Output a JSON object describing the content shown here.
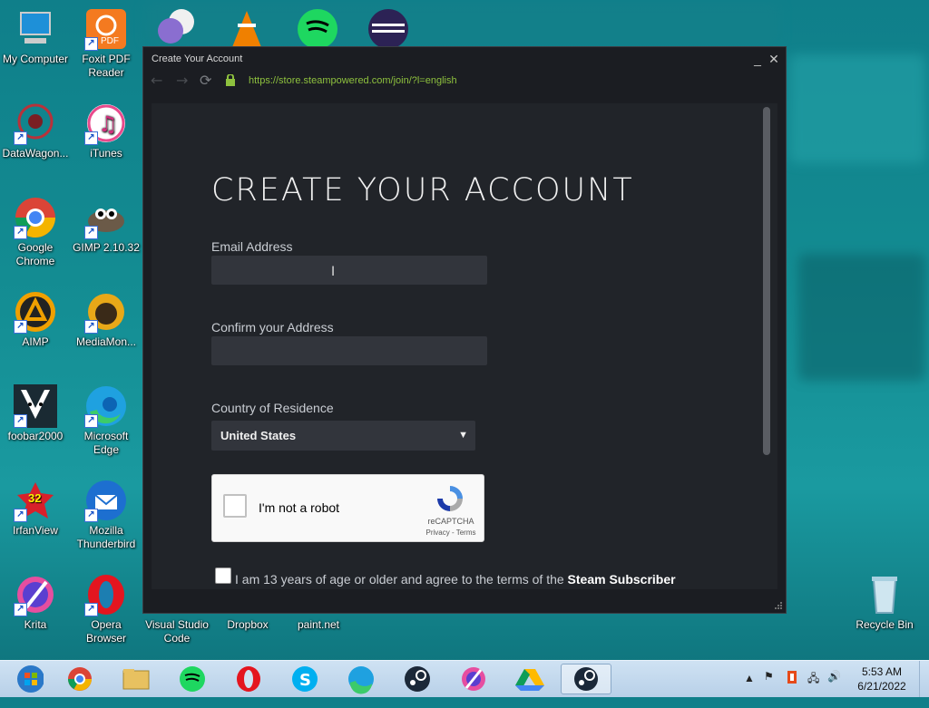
{
  "desktop": {
    "icons": [
      {
        "label": "My Computer"
      },
      {
        "label": "Foxit PDF Reader"
      },
      {
        "label": "DataWagon..."
      },
      {
        "label": "iTunes"
      },
      {
        "label": "Google Chrome"
      },
      {
        "label": "GIMP 2.10.32"
      },
      {
        "label": "AIMP"
      },
      {
        "label": "MediaMon..."
      },
      {
        "label": "foobar2000"
      },
      {
        "label": "Microsoft Edge"
      },
      {
        "label": "IrfanView"
      },
      {
        "label": "Mozilla Thunderbird"
      },
      {
        "label": "Krita"
      },
      {
        "label": "Opera Browser"
      },
      {
        "label": "Visual Studio Code"
      },
      {
        "label": "Dropbox"
      },
      {
        "label": "paint.net"
      },
      {
        "label": "Recycle Bin"
      }
    ],
    "foxit_badge": "PDF",
    "irfan_badge": "32"
  },
  "window": {
    "title": "Create Your Account",
    "minimize": "_",
    "close": "✕",
    "back": "←",
    "forward": "→",
    "reload": "⟳",
    "url": "https://store.steampowered.com/join/?l=english"
  },
  "form": {
    "heading": "CREATE YOUR ACCOUNT",
    "email_label": "Email Address",
    "email_value": "",
    "confirm_label": "Confirm your Address",
    "confirm_value": "",
    "country_label": "Country of Residence",
    "country_value": "United States",
    "captcha_text": "I'm not a robot",
    "captcha_brand": "reCAPTCHA",
    "captcha_links": "Privacy - Terms",
    "agree_text": "I am 13 years of age or older and agree to the terms of the ",
    "agree_link": "Steam Subscriber"
  },
  "taskbar": {
    "apps": [
      "Start",
      "Google Chrome",
      "File Explorer",
      "Spotify",
      "Opera",
      "Skype",
      "Microsoft Edge",
      "Steam",
      "Krita",
      "Google Drive",
      "Steam"
    ],
    "time": "5:53 AM",
    "date": "6/21/2022"
  },
  "colors": {
    "steam_bg": "#1b1d22",
    "content_bg": "#212429",
    "url_green": "#8ec13e",
    "field_bg": "#32353c"
  }
}
